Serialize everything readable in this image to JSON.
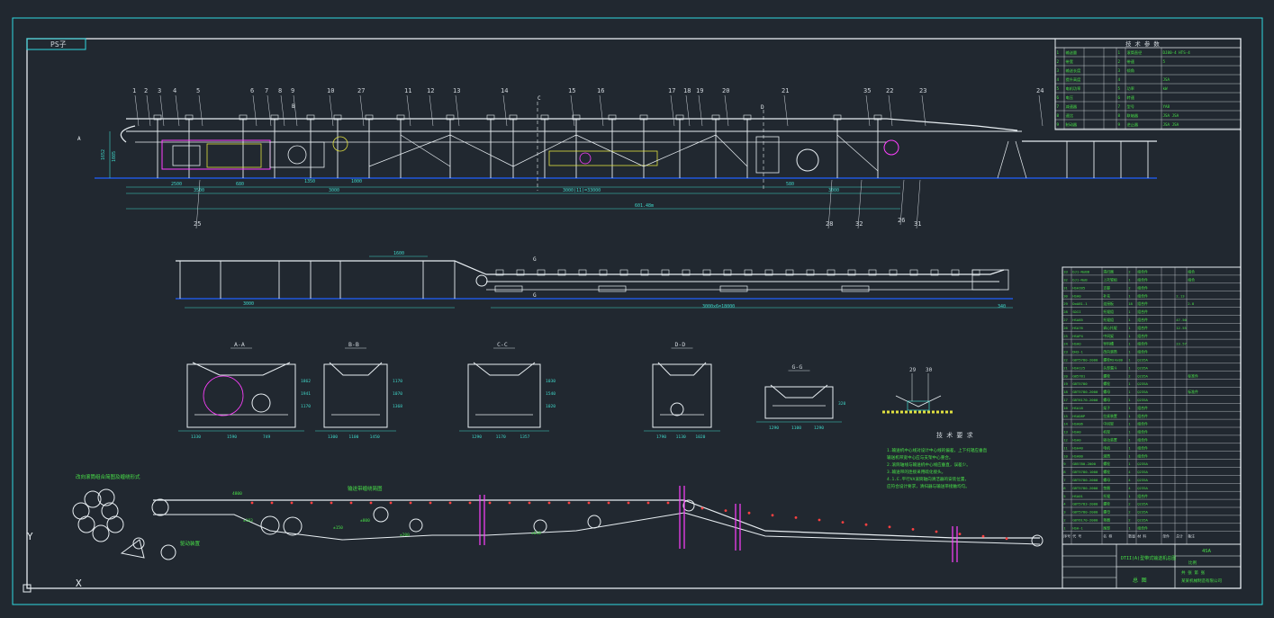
{
  "colors": {
    "background": "#212830",
    "frame": "#2fd8e0",
    "machine": "#e8eef2",
    "dimension": "#3fd6c8",
    "ground": "#2060ff",
    "parts": "#ff40ff",
    "labels": "#d0d6dc",
    "tables": "#48e048",
    "yellow": "#e0e040",
    "red": "#ff4040"
  },
  "drawing": {
    "corner_tag": "PS子",
    "plan_dims": {
      "d1": "2500",
      "d2": "3500",
      "d3": "680",
      "d4": "1350",
      "d5": "1000",
      "d6": "3000",
      "d7": "3000(11)=33000",
      "d8": "580",
      "d9": "3000",
      "total": "601.48m",
      "h1": "1652",
      "h2": "1085"
    },
    "lower_dims": {
      "d1": "1600",
      "d2": "3000",
      "d3": "3000x6=18000",
      "d4": "340"
    },
    "balloons": [
      "1",
      "2",
      "3",
      "4",
      "5",
      "6",
      "7",
      "8",
      "9",
      "10",
      "11",
      "12",
      "13",
      "14",
      "15",
      "16",
      "17",
      "18",
      "19",
      "20",
      "21",
      "35",
      "22",
      "23",
      "24",
      "25",
      "28",
      "32",
      "31",
      "26",
      "27"
    ],
    "section_letters": [
      "A",
      "B",
      "C",
      "D",
      "G"
    ],
    "sections": {
      "s1": {
        "title": "A-A",
        "dims": [
          "1330",
          "1590",
          "749",
          "1862",
          "1941",
          "1170"
        ]
      },
      "s2": {
        "title": "B-B",
        "dims": [
          "1300",
          "1100",
          "1450",
          "1170",
          "1070",
          "1368"
        ]
      },
      "s3": {
        "title": "C-C",
        "dims": [
          "1290",
          "1170",
          "1357",
          "1030",
          "1540",
          "1020"
        ]
      },
      "s4": {
        "title": "D-D",
        "dims": [
          "1790",
          "1130",
          "1020"
        ]
      },
      "s5": {
        "title": "G-G",
        "dims": [
          "1290",
          "1100",
          "1290",
          "320"
        ]
      }
    },
    "detail": {
      "labels": [
        "29",
        "30"
      ]
    }
  },
  "notes": {
    "title": "技 术 要 求",
    "lines": [
      "1.输送机中心线对设计中心线的偏差，上下托辊应垂直",
      "  输送机带宽中心应与支架中心重合。",
      "2.滚筒轴线与输送机中心线应垂直，误差少。",
      "3.输送带的连接采用硫化接头。",
      "4.1.E.平行VA滚筒轴向清洁器的安装位置，",
      "  应符合设计要求，清扫器与输送带接触均匀。"
    ]
  },
  "diagram_labels": {
    "roll_group": "改向滚筒组合简图及缠绕形式",
    "belt_path": "输送带缠绕简图",
    "drive_unit": "驱动装置",
    "dims": [
      "4800",
      "±183",
      "±150",
      "±800",
      "±200",
      "±630"
    ]
  },
  "tech_table": {
    "title": "技 术 参 数",
    "rows": [
      [
        "1",
        "输送量",
        "",
        "",
        "1",
        "滚筒直径",
        "DJ80-4 HTS-4"
      ],
      [
        "2",
        "带宽",
        "",
        "",
        "2",
        "带速",
        "5"
      ],
      [
        "3",
        "输送长度",
        "",
        "",
        "3",
        "倾角",
        ""
      ],
      [
        "4",
        "提升高度",
        "",
        "",
        "4",
        "",
        "JSA"
      ],
      [
        "5",
        "电机功率",
        "",
        "",
        "5",
        "功率",
        "kW"
      ],
      [
        "6",
        "电压",
        "",
        "",
        "6",
        "转速",
        ""
      ],
      [
        "7",
        "减速器",
        "",
        "",
        "7",
        "型号",
        "YA8"
      ],
      [
        "8",
        "速比",
        "",
        "",
        "8",
        "联轴器",
        "JSA JSA"
      ],
      [
        "9",
        "制动器",
        "",
        "",
        "9",
        "逆止器",
        "JSA JSA"
      ]
    ]
  },
  "bom": {
    "rows": [
      [
        "33",
        "DJ1-NoBB",
        "清扫器",
        "2",
        "组合件",
        "",
        "",
        "组合"
      ],
      [
        "32",
        "DJ1-NoB",
        "上托辊组",
        "1",
        "组合件",
        "",
        "",
        "组合"
      ],
      [
        "31",
        "HSAI85",
        "支腿",
        "2",
        "组合件",
        "",
        "",
        ""
      ],
      [
        "30",
        "HSA0",
        "补充",
        "1",
        "组合件",
        "",
        "2.13",
        ""
      ],
      [
        "29",
        "DoA81-1",
        "连接板",
        "18",
        "组合件",
        "",
        "",
        "2.8"
      ],
      [
        "28",
        "SDII",
        "托辊组",
        "1",
        "组合件",
        "",
        "",
        ""
      ],
      [
        "27",
        "HSA85",
        "托辊组",
        "1",
        "组合件",
        "",
        "47.50",
        ""
      ],
      [
        "26",
        "HSA76",
        "调心托辊",
        "1",
        "组合件",
        "",
        "12.55",
        ""
      ],
      [
        "25",
        "HSAP4",
        "中间架",
        "1",
        "组合件",
        "",
        "",
        ""
      ],
      [
        "24",
        "HSAO",
        "导料槽",
        "1",
        "组合件",
        "",
        "23.57",
        ""
      ],
      [
        "23",
        "DH3-1",
        "改向滚筒",
        "1",
        "组合件",
        "",
        "",
        ""
      ],
      [
        "22",
        "GBT5780-2000",
        "螺栓M24x80",
        "1",
        "Q235A",
        "",
        "",
        ""
      ],
      [
        "21",
        "HSA125",
        "头部漏斗",
        "1",
        "Q235A",
        "",
        "",
        ""
      ],
      [
        "20",
        "GB5781",
        "螺栓",
        "2",
        "Q235A",
        "",
        "",
        "标准件"
      ],
      [
        "19",
        "GBT5780",
        "螺栓",
        "1",
        "Q235A",
        "",
        "",
        ""
      ],
      [
        "18",
        "GBT5780-2000",
        "螺母",
        "1",
        "Q235A",
        "",
        "",
        "标准件"
      ],
      [
        "17",
        "GBT6170-2000",
        "螺母",
        "1",
        "Q235A",
        "",
        "",
        ""
      ],
      [
        "16",
        "HSA18",
        "架子",
        "1",
        "组合件",
        "",
        "",
        ""
      ],
      [
        "15",
        "HSAD8P",
        "拉紧装置",
        "1",
        "组合件",
        "",
        "",
        ""
      ],
      [
        "14",
        "HSA06",
        "中间架",
        "1",
        "组合件",
        "",
        "",
        ""
      ],
      [
        "13",
        "HSA0",
        "机架",
        "1",
        "组合件",
        "",
        "",
        ""
      ],
      [
        "12",
        "HSA0",
        "驱动装置",
        "1",
        "组合件",
        "",
        "",
        ""
      ],
      [
        "11",
        "HSA40",
        "电机",
        "1",
        "组合件",
        "",
        "",
        ""
      ],
      [
        "10",
        "HSA80",
        "滚筒",
        "1",
        "组合件",
        "",
        "",
        ""
      ],
      [
        "9",
        "GB5780-2000",
        "螺栓",
        "1",
        "Q235A",
        "",
        "",
        ""
      ],
      [
        "8",
        "GBT5780-1000",
        "螺栓",
        "4",
        "Q235A",
        "",
        "",
        ""
      ],
      [
        "7",
        "GBT5780-2000",
        "螺母",
        "4",
        "Q235A",
        "",
        "",
        ""
      ],
      [
        "6",
        "GBT5780-2000",
        "垫圈",
        "4",
        "Q235A",
        "",
        "",
        ""
      ],
      [
        "5",
        "HSA01",
        "托辊",
        "1",
        "组合件",
        "",
        "",
        ""
      ],
      [
        "4",
        "GBT5783-2000",
        "螺栓",
        "2",
        "Q235A",
        "",
        "",
        ""
      ],
      [
        "3",
        "GBT5780-2000",
        "螺母",
        "2",
        "Q235A",
        "",
        "",
        ""
      ],
      [
        "2",
        "GBT6170-2000",
        "垫圈",
        "2",
        "Q235A",
        "",
        "",
        ""
      ],
      [
        "1",
        "HSA-1",
        "尾部",
        "1",
        "组合件",
        "",
        "",
        ""
      ]
    ],
    "header": [
      "序号",
      "代 号",
      "名 称",
      "数量",
      "材 料",
      "单件",
      "总计",
      "备注"
    ]
  },
  "title_block": {
    "drawing_name": "DTII(A)型带式输送机总图",
    "drawing_no": "4SA",
    "scale_label": "比例",
    "company": "某某机械制造有限公司",
    "sheet": "共 张 第 张",
    "total_label": "总 图"
  },
  "ucs": {
    "x": "X",
    "y": "Y"
  }
}
